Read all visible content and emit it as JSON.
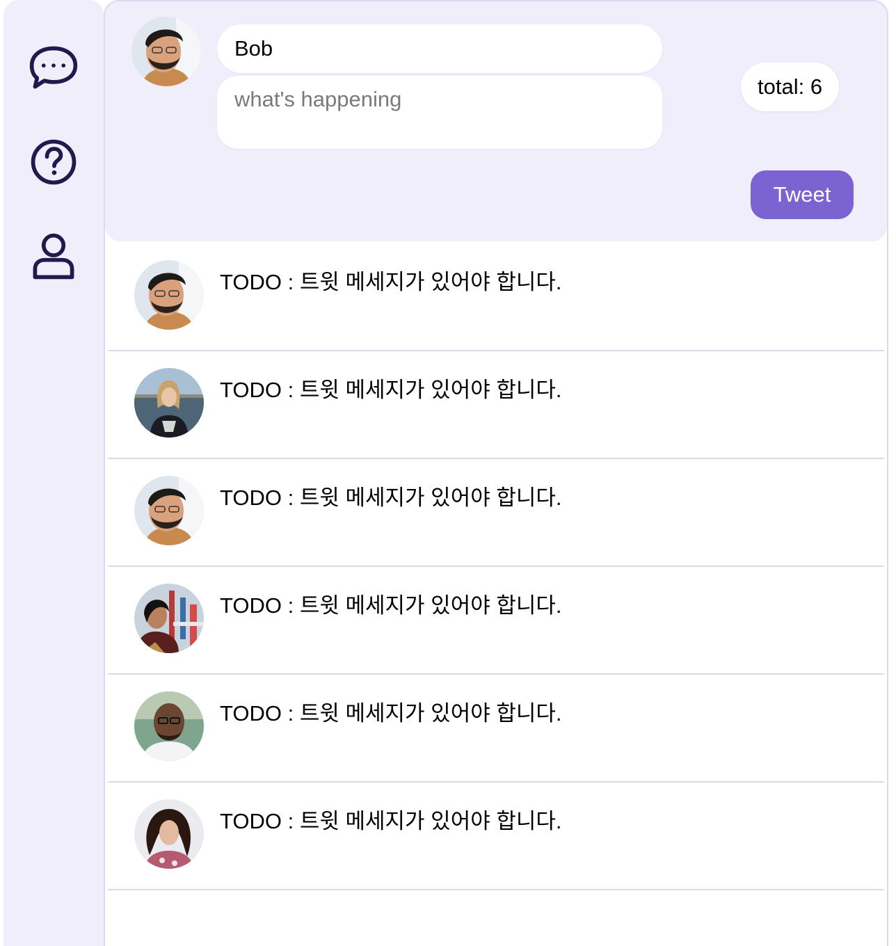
{
  "sidebar": {
    "items": [
      {
        "name": "chat",
        "icon": "chat-bubble-icon"
      },
      {
        "name": "help",
        "icon": "question-circle-icon"
      },
      {
        "name": "profile",
        "icon": "user-icon"
      }
    ],
    "icon_color": "#1f1b4d"
  },
  "composer": {
    "user_avatar": "Bob",
    "name_value": "Bob",
    "tweet_placeholder": "what's happening",
    "total_label": "total: 6",
    "tweet_button": "Tweet"
  },
  "feed": {
    "items": [
      {
        "avatar": "avatar-man-glasses",
        "text": "TODO : 트윗 메세지가 있어야 합니다."
      },
      {
        "avatar": "avatar-woman-blonde",
        "text": "TODO : 트윗 메세지가 있어야 합니다."
      },
      {
        "avatar": "avatar-man-glasses",
        "text": "TODO : 트윗 메세지가 있어야 합니다."
      },
      {
        "avatar": "avatar-woman-dark-hair",
        "text": "TODO : 트윗 메세지가 있어야 합니다."
      },
      {
        "avatar": "avatar-man-bald-glasses",
        "text": "TODO : 트윗 메세지가 있어야 합니다."
      },
      {
        "avatar": "avatar-woman-curly-hair",
        "text": "TODO : 트윗 메세지가 있어야 합니다."
      }
    ]
  },
  "colors": {
    "panel_bg": "#f1eefb",
    "accent": "#7b63d1",
    "border": "#ddd6f5"
  }
}
